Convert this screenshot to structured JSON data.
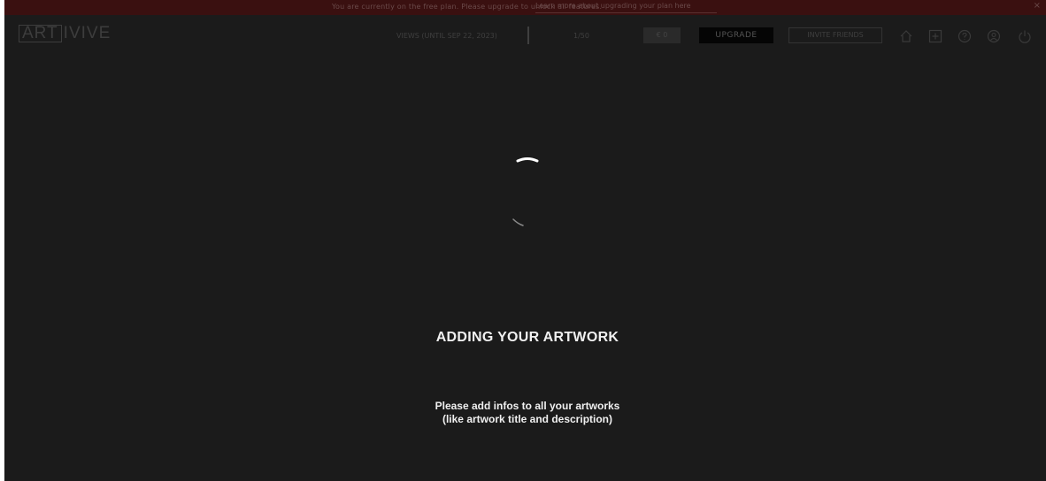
{
  "banner": {
    "message": "You are currently on the free plan. Please upgrade to unlock all features.",
    "link": "Learn more about upgrading your plan here",
    "close": "×"
  },
  "header": {
    "logo_boxed": "ART",
    "logo_rest": "IVIVE",
    "views_label": "VIEWS (UNTIL SEP 22, 2023)",
    "views_count": "1/50",
    "credit": "€ 0",
    "upgrade_label": "UPGRADE",
    "invite_label": "INVITE FRIENDS",
    "icons": [
      "home-icon",
      "add-icon",
      "help-icon",
      "account-icon",
      "power-icon"
    ]
  },
  "main": {
    "title": "ADDING YOUR ARTWORK",
    "subtitle_line1": "Please add infos to all your artworks",
    "subtitle_line2": "(like artwork title and description)"
  },
  "colors": {
    "background": "#1b1b1b",
    "banner": "#3a1010",
    "text": "#f0f0f0"
  }
}
